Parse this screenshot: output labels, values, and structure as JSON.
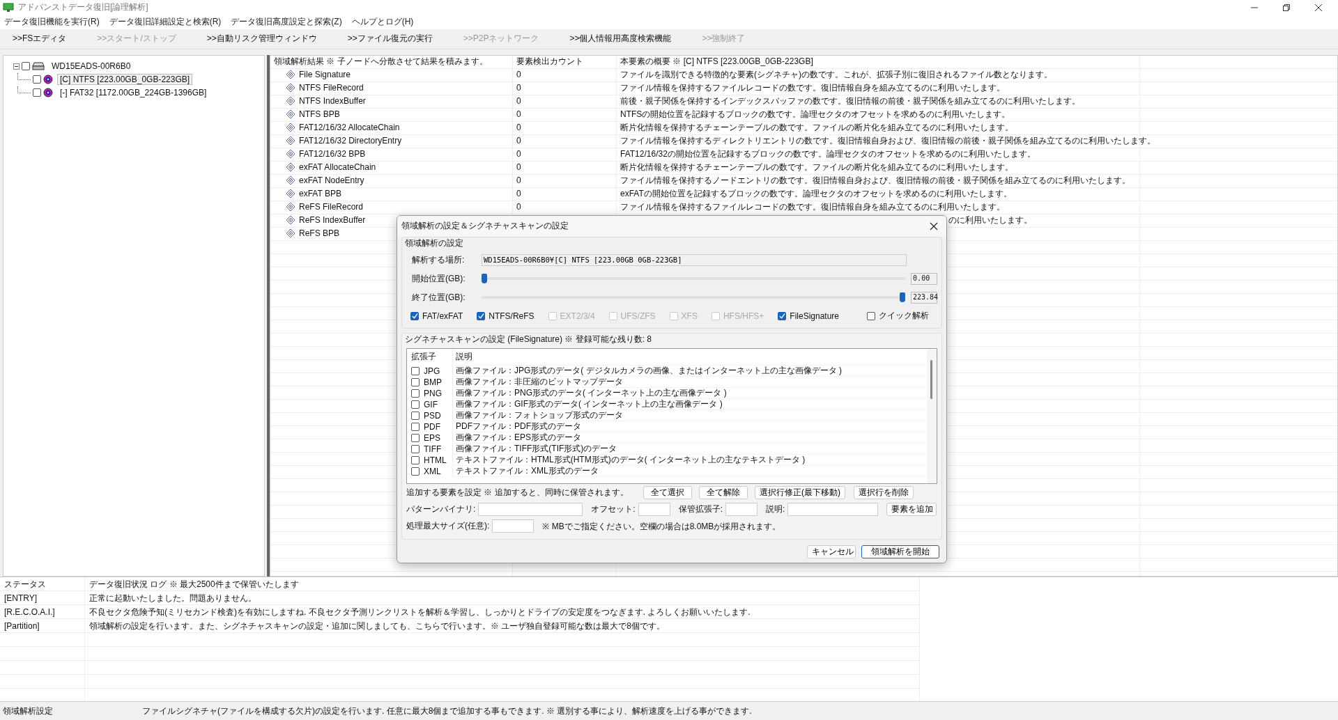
{
  "window": {
    "title": "アドバンストデータ復旧[論理解析]"
  },
  "menu": [
    "データ復旧機能を実行(R)",
    "データ復旧詳細設定と検索(R)",
    "データ復旧高度設定と探索(Z)",
    "ヘルプとログ(H)"
  ],
  "toolbar": [
    {
      "label": ">>FSエディタ",
      "disabled": false
    },
    {
      "label": ">>スタート/ストップ",
      "disabled": true
    },
    {
      "label": ">>自動リスク管理ウィンドウ",
      "disabled": false
    },
    {
      "label": ">>ファイル復元の実行",
      "disabled": false
    },
    {
      "label": ">>P2Pネットワーク",
      "disabled": true
    },
    {
      "label": ">>個人情報用高度検索機能",
      "disabled": false
    },
    {
      "label": ">>強制終了",
      "disabled": true
    }
  ],
  "tree": [
    {
      "label": "WD15EADS-00R6B0",
      "kind": "drive",
      "checked": false,
      "expanded": true,
      "selected": false,
      "children": [
        {
          "label": "[C] NTFS [223.00GB_0GB-223GB]",
          "kind": "partition",
          "checked": false,
          "selected": true
        },
        {
          "label": "[-] FAT32 [1172.00GB_224GB-1396GB]",
          "kind": "partition",
          "checked": false,
          "selected": false
        }
      ]
    }
  ],
  "results": {
    "columns": [
      "領域解析結果 ※ 子ノードへ分散させて結果を積みます。",
      "要素検出カウント",
      "本要素の概要 ※ [C] NTFS [223.00GB_0GB-223GB]"
    ],
    "rows": [
      {
        "name": "File Signature",
        "count": "0",
        "description": "ファイルを識別できる特徴的な要素(シグネチャ)の数です。これが、拡張子別に復旧されるファイル数となります。"
      },
      {
        "name": "NTFS FileRecord",
        "count": "0",
        "description": "ファイル情報を保持するファイルレコードの数です。復旧情報自身を組み立てるのに利用いたします。"
      },
      {
        "name": "NTFS IndexBuffer",
        "count": "0",
        "description": "前後・親子関係を保持するインデックスバッファの数です。復旧情報の前後・親子関係を組み立てるのに利用いたします。"
      },
      {
        "name": "NTFS BPB",
        "count": "0",
        "description": "NTFSの開始位置を記録するブロックの数です。論理セクタのオフセットを求めるのに利用いたします。"
      },
      {
        "name": "FAT12/16/32 AllocateChain",
        "count": "0",
        "description": "断片化情報を保持するチェーンテーブルの数です。ファイルの断片化を組み立てるのに利用いたします。"
      },
      {
        "name": "FAT12/16/32 DirectoryEntry",
        "count": "0",
        "description": "ファイル情報を保持するディレクトリエントリの数です。復旧情報自身および、復旧情報の前後・親子関係を組み立てるのに利用いたします。"
      },
      {
        "name": "FAT12/16/32 BPB",
        "count": "0",
        "description": "FAT12/16/32の開始位置を記録するブロックの数です。論理セクタのオフセットを求めるのに利用いたします。"
      },
      {
        "name": "exFAT AllocateChain",
        "count": "0",
        "description": "断片化情報を保持するチェーンテーブルの数です。ファイルの断片化を組み立てるのに利用いたします。"
      },
      {
        "name": "exFAT NodeEntry",
        "count": "0",
        "description": "ファイル情報を保持するノードエントリの数です。復旧情報自身および、復旧情報の前後・親子関係を組み立てるのに利用いたします。"
      },
      {
        "name": "exFAT BPB",
        "count": "0",
        "description": "exFATの開始位置を記録するブロックの数です。論理セクタのオフセットを求めるのに利用いたします。"
      },
      {
        "name": "ReFS FileRecord",
        "count": "0",
        "description": "ファイル情報を保持するファイルレコードの数です。復旧情報自身を組み立てるのに利用いたします。"
      },
      {
        "name": "ReFS IndexBuffer",
        "description": "のに利用いたします。",
        "partly_hidden": true
      },
      {
        "name": "ReFS BPB"
      }
    ]
  },
  "dialog": {
    "title": "領域解析の設定＆シグネチャスキャンの設定",
    "area_group": {
      "title": "領域解析の設定",
      "location": {
        "label": "解析する場所:",
        "value": "WD15EADS-00R6B0¥[C] NTFS [223.00GB_0GB-223GB]"
      },
      "sliders": [
        {
          "label": "開始位置(GB):",
          "level": 0,
          "reading": "0.00"
        },
        {
          "label": "終了位置(GB):",
          "level": 1,
          "reading": "223.84"
        }
      ],
      "filesystems": [
        {
          "label": "FAT/exFAT",
          "checked": true,
          "disabled": false
        },
        {
          "label": "NTFS/ReFS",
          "checked": true,
          "disabled": false
        },
        {
          "label": "EXT2/3/4",
          "checked": false,
          "disabled": true
        },
        {
          "label": "UFS/ZFS",
          "checked": false,
          "disabled": true
        },
        {
          "label": "XFS",
          "checked": false,
          "disabled": true
        },
        {
          "label": "HFS/HFS+",
          "checked": false,
          "disabled": true
        },
        {
          "label": "FileSignature",
          "checked": true,
          "disabled": false
        }
      ],
      "quick": {
        "label": "クイック解析",
        "checked": false
      }
    },
    "signature_group": {
      "title": "シグネチャスキャンの設定 (FileSignature) ※ 登録可能な残り数: 8",
      "columns": [
        "拡張子",
        "説明"
      ],
      "rows": [
        {
          "ext": "JPG",
          "checked": false,
          "description": "画像ファイル：JPG形式のデータ( デジタルカメラの画像、またはインターネット上の主な画像データ )"
        },
        {
          "ext": "BMP",
          "checked": false,
          "description": "画像ファイル：非圧縮のビットマップデータ"
        },
        {
          "ext": "PNG",
          "checked": false,
          "description": "画像ファイル：PNG形式のデータ( インターネット上の主な画像データ )"
        },
        {
          "ext": "GIF",
          "checked": false,
          "description": "画像ファイル：GIF形式のデータ( インターネット上の主な画像データ )"
        },
        {
          "ext": "PSD",
          "checked": false,
          "description": "画像ファイル：フォトショップ形式のデータ"
        },
        {
          "ext": "PDF",
          "checked": false,
          "description": "PDFファイル：PDF形式のデータ"
        },
        {
          "ext": "EPS",
          "checked": false,
          "description": "画像ファイル：EPS形式のデータ"
        },
        {
          "ext": "TIFF",
          "checked": false,
          "description": "画像ファイル：TIFF形式(TIF形式)のデータ"
        },
        {
          "ext": "HTML",
          "checked": false,
          "description": "テキストファイル：HTML形式(HTM形式)のデータ( インターネット上の主なテキストデータ )"
        },
        {
          "ext": "XML",
          "checked": false,
          "description": "テキストファイル：XML形式のデータ"
        }
      ]
    },
    "add_section": {
      "title": "追加する要素を設定 ※ 追加すると、同時に保管されます。",
      "buttons": [
        "全て選択",
        "全て解除",
        "選択行修正(最下移動)",
        "選択行を削除"
      ],
      "fields": [
        {
          "label": "パターンバイナリ:"
        },
        {
          "label": "オフセット:"
        },
        {
          "label": "保管拡張子:"
        },
        {
          "label": "説明:"
        }
      ],
      "add_button": "要素を追加",
      "max_size": {
        "label": "処理最大サイズ(任意):",
        "note": "※ MBでご指定ください。空欄の場合は8.0MBが採用されます。"
      }
    },
    "buttons": [
      {
        "label": "キャンセル",
        "default": false
      },
      {
        "label": "領域解析を開始",
        "default": true
      }
    ]
  },
  "log": {
    "columns": [
      "ステータス",
      "データ復旧状況 ログ ※ 最大2500件まで保管いたします"
    ],
    "rows": [
      {
        "status": "[ENTRY]",
        "message": "正常に起動いたしました。問題ありません。"
      },
      {
        "status": "[R.E.C.O.A.I.]",
        "message": "不良セクタ危険予知(ミリセカンド検査)を有効にしますね. 不良セクタ予測リンクリストを解析＆学習し、しっかりとドライブの安定度をつなぎます. よろしくお願いいたします."
      },
      {
        "status": "[Partition]",
        "message": "領域解析の設定を行います。また、シグネチャスキャンの設定・追加に関しましても、こちらで行います。※ ユーザ独自登録可能な数は最大で8個です。"
      }
    ]
  },
  "status_bar": {
    "section": "領域解析設定",
    "message": "ファイルシグネチャ(ファイルを構成する欠片)の設定を行います. 任意に最大8個まで追加する事もできます. ※ 選別する事により、解析速度を上げる事ができます."
  }
}
